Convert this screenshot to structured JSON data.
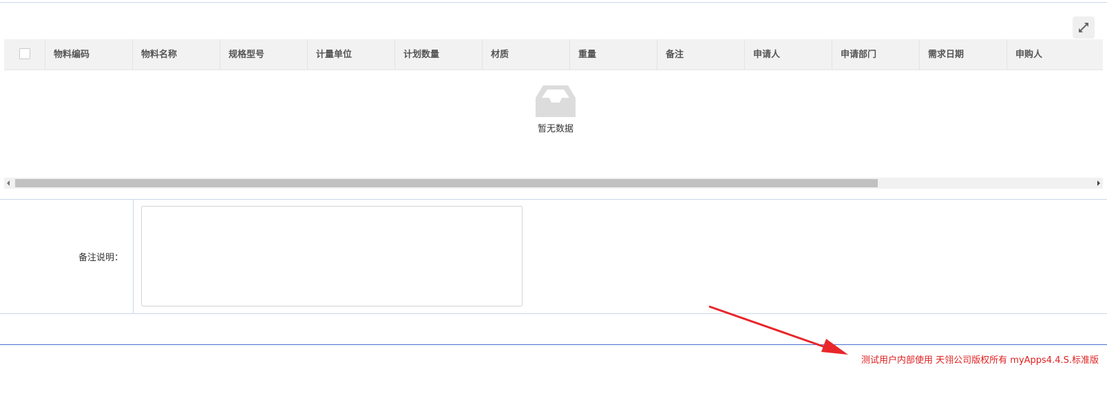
{
  "table": {
    "columns": [
      "物料编码",
      "物料名称",
      "规格型号",
      "计量单位",
      "计划数量",
      "材质",
      "重量",
      "备注",
      "申请人",
      "申请部门",
      "需求日期",
      "申购人"
    ],
    "empty_text": "暂无数据"
  },
  "toolbar": {
    "expand_icon": "expand-icon"
  },
  "form": {
    "remark_label": "备注说明：",
    "remark_value": ""
  },
  "footer": {
    "note": "测试用户内部使用 天翎公司版权所有 myApps4.4.S.标准版"
  },
  "colors": {
    "note_red": "#e02020",
    "arrow_red": "#e8262b",
    "rule_blue": "#c9d8ea"
  }
}
